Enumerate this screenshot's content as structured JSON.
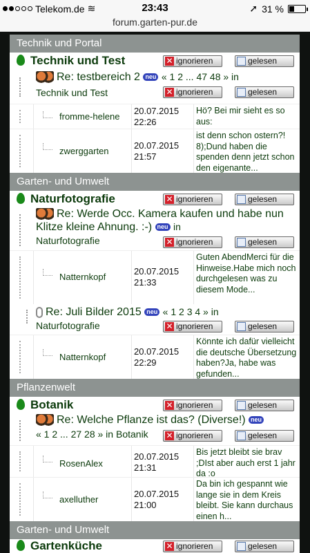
{
  "status_bar": {
    "carrier": "Telekom.de",
    "time": "23:43",
    "battery": "31 %",
    "battery_level": 0.31
  },
  "url_bar": {
    "url": "forum.garten-pur.de"
  },
  "buttons": {
    "ignore": "ignorieren",
    "read": "gelesen"
  },
  "new_badge": "neu",
  "categories": [
    "Technik und Portal",
    "Garten- und Umwelt",
    "Pflanzenwelt",
    "Garten- und Umwelt"
  ],
  "boards": [
    {
      "title": "Technik und Test",
      "topic": {
        "prefix": "Re: testbereich 2",
        "pages": "« 1 2 ... 47 48 » in",
        "board": "Technik und Test"
      },
      "posts": [
        {
          "user": "fromme-helene",
          "date": "20.07.2015",
          "time": "22:26",
          "msg": "Hö? Bei mir sieht es so aus:"
        },
        {
          "user": "zwerggarten",
          "date": "20.07.2015",
          "time": "21:57",
          "msg": "ist denn schon ostern?! 8);Dund haben die spenden denn jetzt schon den eigenante..."
        }
      ]
    },
    {
      "title": "Naturfotografie",
      "topic": {
        "prefix": "Re: Werde Occ. Kamera kaufen und habe nun Klitze kleine Ahnung. :-)",
        "in": "in",
        "board": "Naturfotografie"
      },
      "posts": [
        {
          "user": "Natternkopf",
          "date": "20.07.2015",
          "time": "21:33",
          "msg": "Guten AbendMerci für die Hinweise.Habe mich noch durchgelesen was zu diesem Mode..."
        }
      ],
      "topic2": {
        "prefix": "Re: Juli Bilder 2015",
        "pages": "« 1 2 3 4 » in",
        "board": "Naturfotografie"
      },
      "posts2": [
        {
          "user": "Natternkopf",
          "date": "20.07.2015",
          "time": "22:29",
          "msg": "Könnte ich dafür vielleicht die deutsche Übersetzung haben?Ja, habe was gefunden..."
        }
      ]
    },
    {
      "title": "Botanik",
      "topic": {
        "prefix": "Re: Welche Pflanze ist das? (Diverse!)",
        "pages": "« 1 2 ... 27 28 » in",
        "board": "Botanik"
      },
      "posts": [
        {
          "user": "RosenAlex",
          "date": "20.07.2015",
          "time": "21:31",
          "msg": "Bis jetzt bleibt sie brav  ;DIst aber auch erst 1 jahr da :o"
        },
        {
          "user": "axelluther",
          "date": "20.07.2015",
          "time": "21:00",
          "msg": "Da bin ich gespannt wie lange sie in dem Kreis bleibt. Sie kann durchaus einen h..."
        }
      ]
    },
    {
      "title": "Gartenküche"
    }
  ]
}
